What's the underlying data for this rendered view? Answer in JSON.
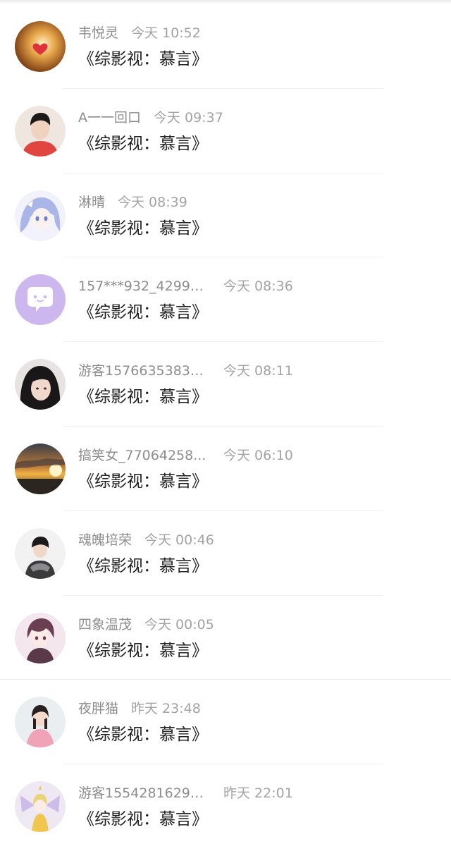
{
  "messages": [
    {
      "name": "韦悦灵",
      "time": "今天 10:52",
      "title": "《综影视：慕言》",
      "avatar_icon": "glowing-heart-avatar-icon"
    },
    {
      "name": "A一一回口",
      "time": "今天 09:37",
      "title": "《综影视：慕言》",
      "avatar_icon": "young-man-red-hoodie-avatar-icon"
    },
    {
      "name": "淋晴",
      "time": "今天 08:39",
      "title": "《综影视：慕言》",
      "avatar_icon": "anime-blue-hair-girl-avatar-icon"
    },
    {
      "name": "157***932_42994...",
      "time": "今天 08:36",
      "title": "《综影视：慕言》",
      "avatar_icon": "purple-chat-bubble-avatar-icon"
    },
    {
      "name": "游客15766353835...",
      "time": "今天 08:11",
      "title": "《综影视：慕言》",
      "avatar_icon": "girl-portrait-avatar-icon"
    },
    {
      "name": "搞笑女_77064258...",
      "time": "今天 06:10",
      "title": "《综影视：慕言》",
      "avatar_icon": "sunset-avatar-icon"
    },
    {
      "name": "魂魄培荣",
      "time": "今天 00:46",
      "title": "《综影视：慕言》",
      "avatar_icon": "person-grey-jacket-avatar-icon"
    },
    {
      "name": "四象温茂",
      "time": "今天 00:05",
      "title": "《综影视：慕言》",
      "avatar_icon": "anime-boy-pink-avatar-icon"
    },
    {
      "name": "夜胖猫",
      "time": "昨天 23:48",
      "title": "《综影视：慕言》",
      "avatar_icon": "girl-pink-dress-avatar-icon"
    },
    {
      "name": "游客15542816290...",
      "time": "昨天 22:01",
      "title": "《综影视：慕言》",
      "avatar_icon": "anime-fairy-avatar-icon"
    }
  ]
}
